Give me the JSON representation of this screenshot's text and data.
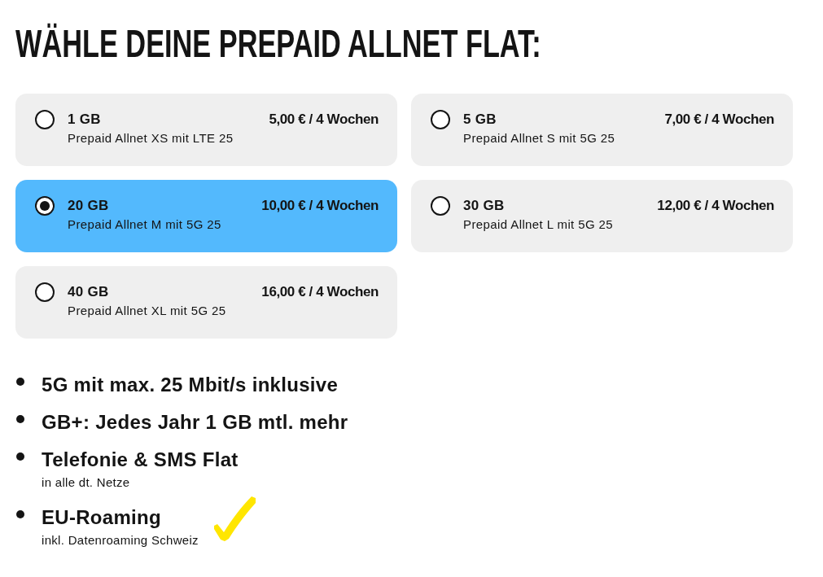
{
  "heading": "WÄHLE DEINE PREPAID ALLNET FLAT:",
  "plans": [
    {
      "data": "1 GB",
      "name": "Prepaid Allnet XS mit LTE 25",
      "price": "5,00 € / 4 Wochen",
      "selected": false
    },
    {
      "data": "5 GB",
      "name": "Prepaid Allnet S mit 5G 25",
      "price": "7,00 € / 4 Wochen",
      "selected": false
    },
    {
      "data": "20 GB",
      "name": "Prepaid Allnet M mit 5G 25",
      "price": "10,00 € / 4 Wochen",
      "selected": true
    },
    {
      "data": "30 GB",
      "name": "Prepaid Allnet L mit 5G 25",
      "price": "12,00 € / 4 Wochen",
      "selected": false
    },
    {
      "data": "40 GB",
      "name": "Prepaid Allnet XL mit 5G 25",
      "price": "16,00 € / 4 Wochen",
      "selected": false
    }
  ],
  "features": [
    {
      "title": "5G mit max. 25 Mbit/s inklusive",
      "marked": false
    },
    {
      "title": "GB+: Jedes Jahr 1 GB mtl. mehr",
      "marked": false
    },
    {
      "title": "Telefonie & SMS Flat",
      "note": "in alle dt. Netze",
      "marked": false
    },
    {
      "title": "EU-Roaming",
      "note": "inkl. Datenroaming Schweiz",
      "marked": true
    }
  ]
}
